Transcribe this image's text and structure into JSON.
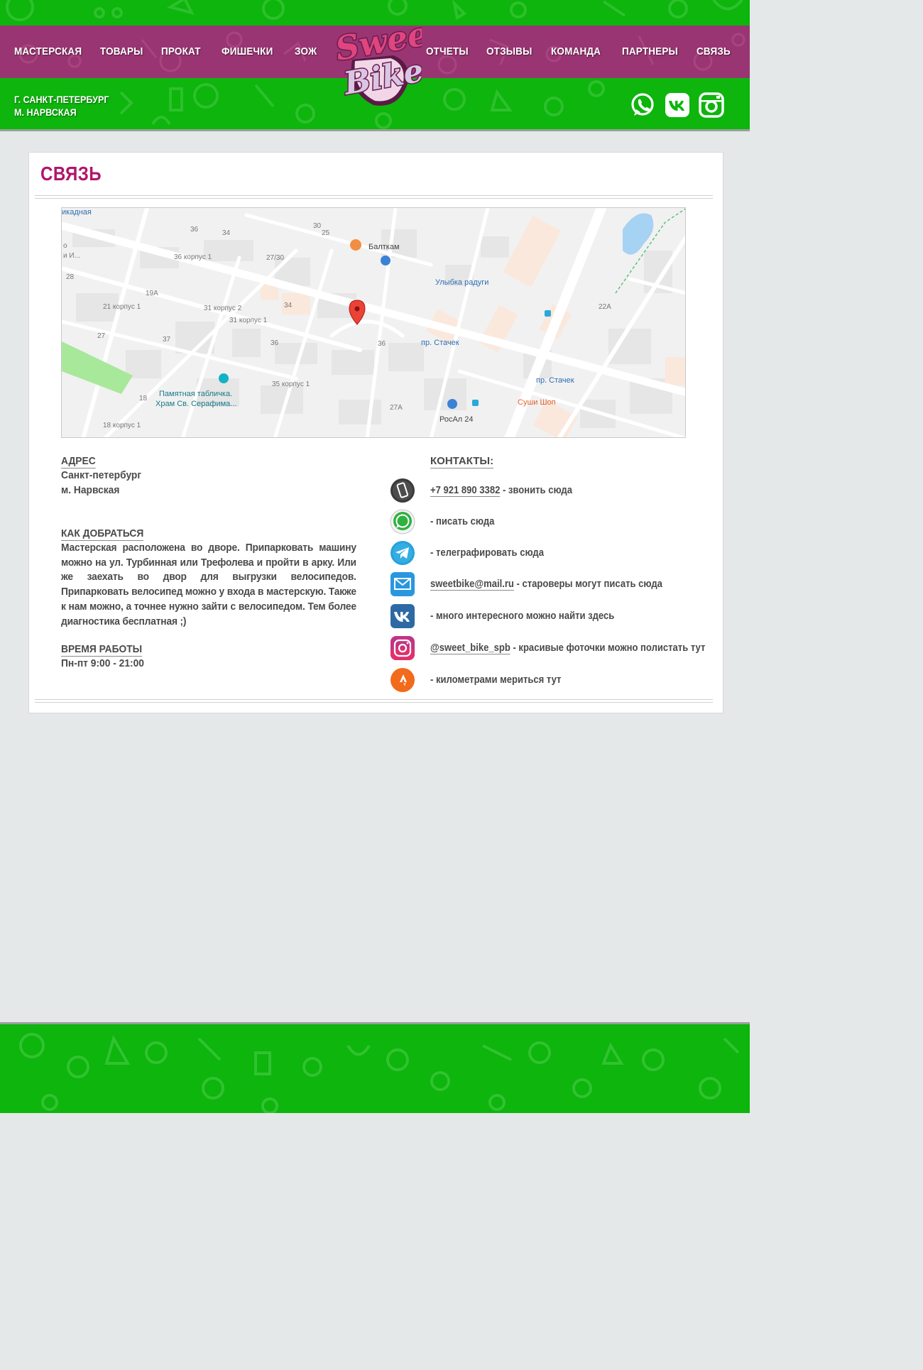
{
  "header": {
    "nav_left": [
      "МАСТЕРСКАЯ",
      "ТОВАРЫ",
      "ПРОКАТ",
      "ФИШЕЧКИ",
      "ЗОЖ"
    ],
    "nav_right": [
      "ОТЧЕТЫ",
      "ОТЗЫВЫ",
      "КОМАНДА",
      "ПАРТНЕРЫ",
      "СВЯЗЬ"
    ],
    "logo_text": [
      "Sweet",
      "Bike"
    ],
    "city_line1": "Г. САНКТ-ПЕТЕРБУРГ",
    "city_line2": "М. НАРВСКАЯ",
    "social_icons": [
      "whatsapp-icon",
      "vk-icon",
      "instagram-icon"
    ]
  },
  "main": {
    "title": "СВЯЗЬ",
    "map": {
      "labels": {
        "top_left": "икадная",
        "baltkam": "Балткам",
        "ulybka": "Улыбка радуги",
        "stachek1": "пр. Стачек",
        "stachek2": "пр. Стачек",
        "pamyatnaya1": "Памятная табличка.",
        "pamyatnaya2": "Храм Св. Серафима...",
        "sushi": "Суши Шоп",
        "rosal": "РосАл 24",
        "edge1": "о",
        "edge2": "и И...",
        "n28": "28",
        "n36a": "36",
        "n34a": "34",
        "n30": "30",
        "n25": "25",
        "n36k1": "36 корпус 1",
        "n2730": "27/30",
        "n19a": "19А",
        "n21k1": "21 корпус 1",
        "n31k2": "31 корпус 2",
        "n31k1": "31 корпус 1",
        "n34b": "34",
        "n27": "27",
        "n37": "37",
        "n36b": "36",
        "n36c": "36",
        "n35k1": "35 корпус 1",
        "n18": "18",
        "n27a": "27А",
        "n18k1": "18 корпус 1",
        "n22a": "22А"
      }
    },
    "address": {
      "heading": "АДРЕС",
      "line1": "Санкт-петербург",
      "line2": "м. Нарвская"
    },
    "directions": {
      "heading": "КАК ДОБРАТЬСЯ",
      "text": "Мастерская расположена во дворе. Припарковать машину можно на ул. Турбинная или Трефолева и пройти в арку. Или же заехать во двор для выгрузки велосипедов. Припарковать велосипед можно у входа в мастерскую. Также к нам можно, а точнее нужно зайти с велосипедом. Тем более диагностика бесплатная ;)"
    },
    "hours": {
      "heading": "ВРЕМЯ РАБОТЫ",
      "text": "Пн-пт 9:00 - 21:00"
    },
    "contacts": {
      "heading": "КОНТАКТЫ:",
      "items": [
        {
          "icon": "phone-icon",
          "link": "+7 921 890 3382",
          "text": " - звонить сюда"
        },
        {
          "icon": "whatsapp-icon",
          "link": "",
          "text": "- писать сюда"
        },
        {
          "icon": "telegram-icon",
          "link": "",
          "text": "- телеграфировать сюда"
        },
        {
          "icon": "mail-icon",
          "link": "sweetbike@mail.ru",
          "text": " - староверы могут писать сюда"
        },
        {
          "icon": "vk-icon",
          "link": "",
          "text": "- много интересного можно найти здесь"
        },
        {
          "icon": "instagram-icon",
          "link": "@sweet_bike_spb",
          "text": " - красивые фоточки можно полистать тут"
        },
        {
          "icon": "strava-icon",
          "link": "",
          "text": "- километрами мериться тут"
        }
      ]
    }
  },
  "colors": {
    "header_green": "#0db50c",
    "nav_purple": "#9a3573",
    "title_magenta": "#b0166b",
    "page_bg": "#e4e8e9",
    "text_gray": "#4a4a4a"
  }
}
